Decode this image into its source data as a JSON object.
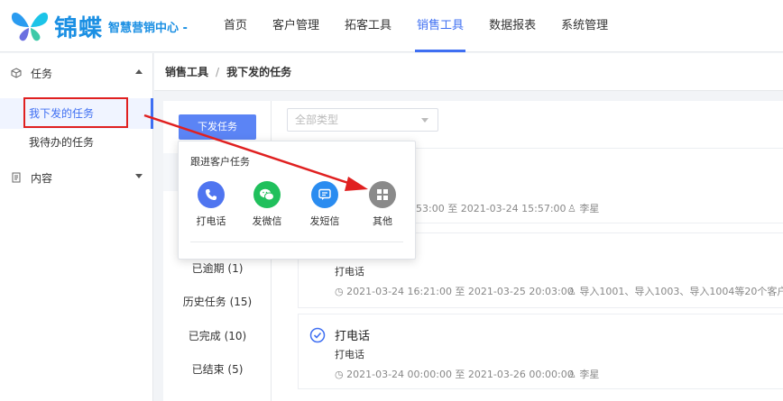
{
  "header": {
    "brand": "锦蝶",
    "subtitle": "智慧营销中心 -",
    "nav": [
      {
        "label": "首页"
      },
      {
        "label": "客户管理"
      },
      {
        "label": "拓客工具"
      },
      {
        "label": "销售工具",
        "active": true
      },
      {
        "label": "数据报表"
      },
      {
        "label": "系统管理"
      }
    ]
  },
  "sidebar": {
    "group1": "任务",
    "items": [
      "我下发的任务",
      "我待办的任务"
    ],
    "group2": "内容"
  },
  "breadcrumb": {
    "parent": "销售工具",
    "sep": "/",
    "current": "我下发的任务"
  },
  "toolbar": {
    "issue_button": "下发任务",
    "type_select": "全部类型"
  },
  "status_tabs": [
    "已逾期 (1)",
    "历史任务 (15)",
    "已完成 (10)",
    "已结束 (5)"
  ],
  "popup": {
    "title": "跟进客户任务",
    "options": [
      {
        "label": "打电话",
        "icon": "phone-icon",
        "color": "#4f75f0"
      },
      {
        "label": "发微信",
        "icon": "wechat-icon",
        "color": "#20c05c"
      },
      {
        "label": "发短信",
        "icon": "message-icon",
        "color": "#2a8cf0"
      },
      {
        "label": "其他",
        "icon": "grid-icon",
        "color": "#8a8a8a"
      }
    ]
  },
  "tasks": [
    {
      "meta": "53:00 至 2021-03-24 15:57:00",
      "user": "李星"
    },
    {
      "subtitle": "打电话",
      "meta": "2021-03-24 16:21:00 至 2021-03-25 20:03:00",
      "user": "导入1001、导入1003、导入1004等20个客户"
    },
    {
      "title": "打电话",
      "subtitle": "打电话",
      "meta": "2021-03-24 00:00:00 至 2021-03-26 00:00:00",
      "user": "李星"
    }
  ],
  "colors": {
    "accent": "#3f6ff2",
    "highlight": "#e02020"
  }
}
